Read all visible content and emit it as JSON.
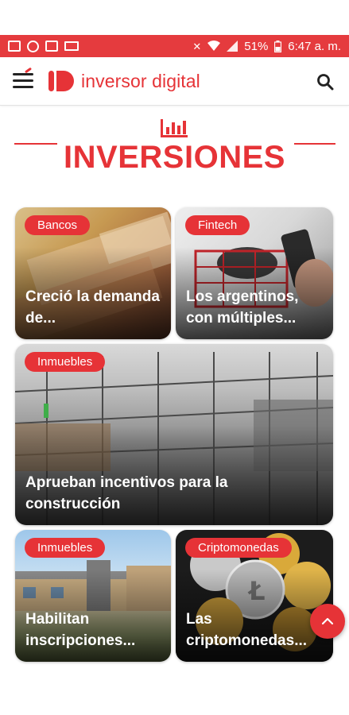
{
  "status_bar": {
    "battery": "51%",
    "time": "6:47 a. m.",
    "left_icons": [
      "message-icon",
      "whatsapp-icon",
      "activity-icon",
      "laptop-icon"
    ],
    "right_icons": [
      "mute-icon",
      "wifi-icon",
      "signal-icon",
      "battery-icon"
    ]
  },
  "header": {
    "logo_text": "inversor digital",
    "brand_color": "#e63337"
  },
  "section": {
    "title": "INVERSIONES",
    "icon": "chart-bars-icon"
  },
  "cards": [
    {
      "tag": "Bancos",
      "title": "Creció la demanda de..."
    },
    {
      "tag": "Fintech",
      "title": "Los argentinos, con múltiples..."
    },
    {
      "tag": "Inmuebles",
      "title": "Aprueban incentivos para la construcción"
    },
    {
      "tag": "Inmuebles",
      "title": "Habilitan inscripciones..."
    },
    {
      "tag": "Criptomonedas",
      "title": "Las criptomonedas..."
    }
  ],
  "colors": {
    "accent": "#e63337",
    "status_bar": "#e53b3e"
  }
}
